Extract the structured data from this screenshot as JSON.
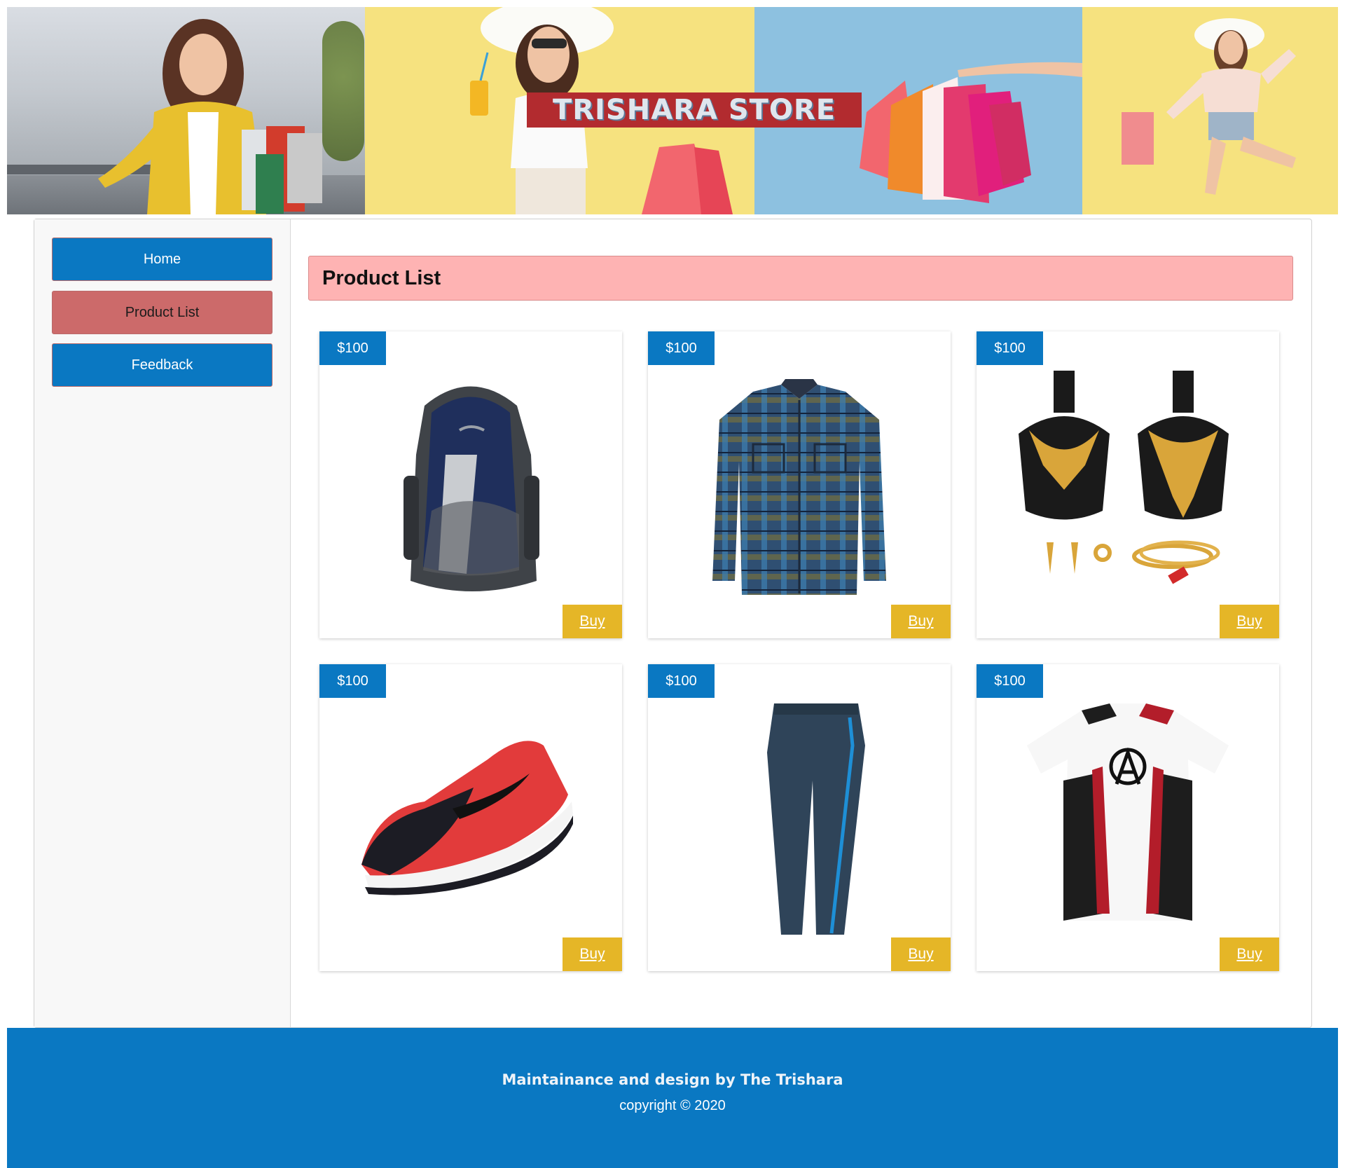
{
  "banner": {
    "store_name": "TRISHARA STORE"
  },
  "sidebar": {
    "items": [
      {
        "label": "Home"
      },
      {
        "label": "Product List"
      },
      {
        "label": "Feedback"
      }
    ]
  },
  "main": {
    "heading": "Product List",
    "products": [
      {
        "price": "$100",
        "buy_label": "Buy",
        "image": "backpack-image"
      },
      {
        "price": "$100",
        "buy_label": "Buy",
        "image": "plaid-shirt-image"
      },
      {
        "price": "$100",
        "buy_label": "Buy",
        "image": "gold-jewellery-set-image"
      },
      {
        "price": "$100",
        "buy_label": "Buy",
        "image": "running-shoe-image"
      },
      {
        "price": "$100",
        "buy_label": "Buy",
        "image": "track-pants-image"
      },
      {
        "price": "$100",
        "buy_label": "Buy",
        "image": "avengers-tshirt-image"
      }
    ]
  },
  "footer": {
    "credit": "Maintainance and design by The Trishara",
    "copyright": "copyright © 2020"
  },
  "colors": {
    "primary_blue": "#0a78c2",
    "active_nav": "#cc6a6a",
    "heading_bg": "#feb3b3",
    "buy_button": "#e5b627",
    "banner_yellow": "#f6e27f",
    "banner_blue": "#8dc1e0",
    "title_red": "#b22b2f"
  }
}
